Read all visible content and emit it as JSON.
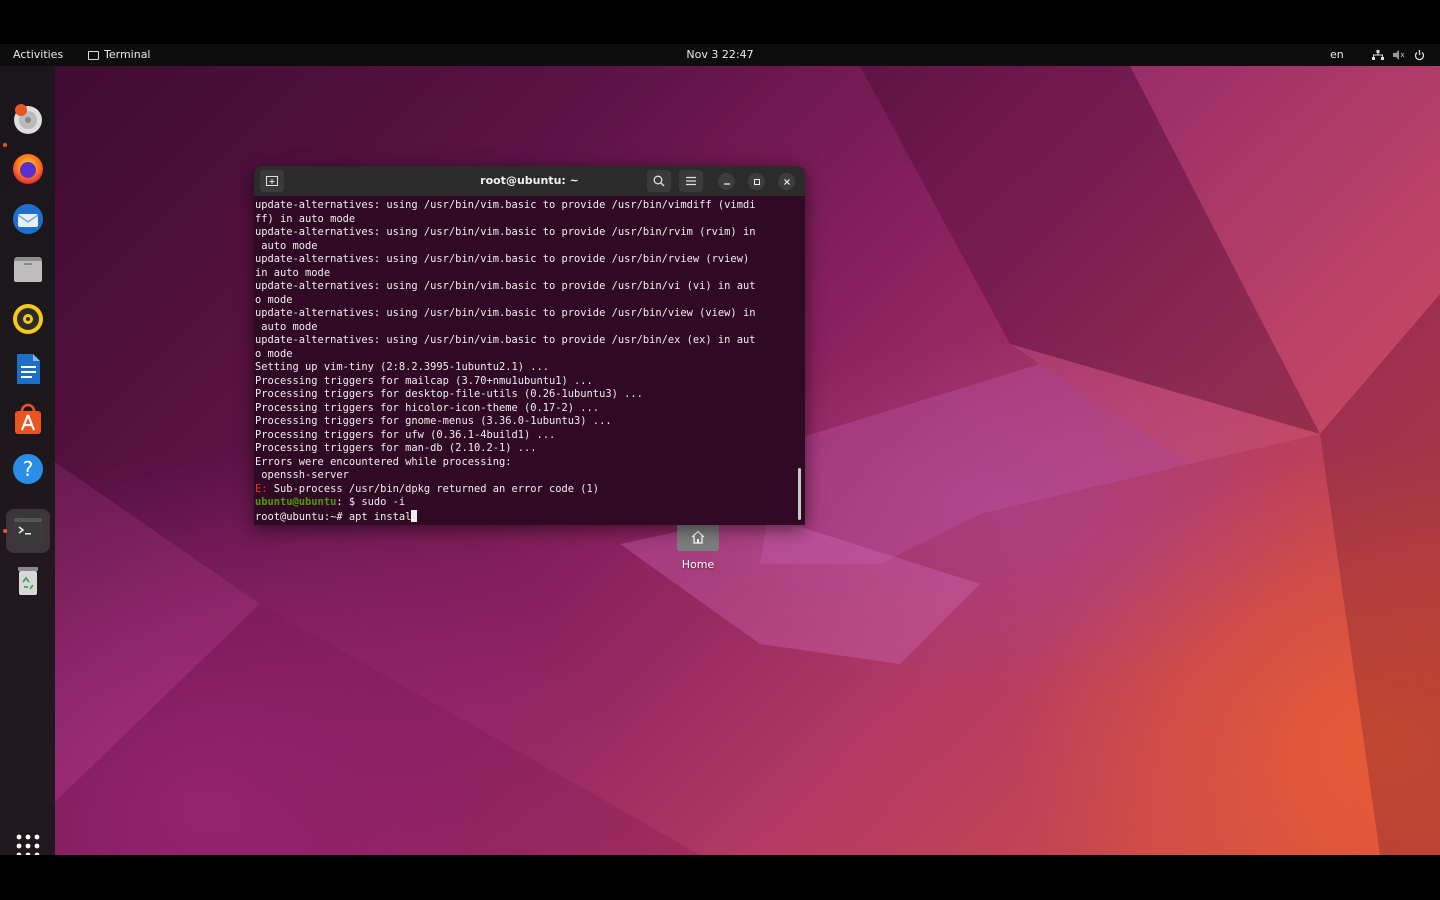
{
  "topbar": {
    "activities": "Activities",
    "app_name": "Terminal",
    "clock": "Nov 3  22:47",
    "lang": "en"
  },
  "dock": {
    "items": [
      {
        "icon": "installer-icon"
      },
      {
        "icon": "firefox-icon"
      },
      {
        "icon": "thunderbird-icon"
      },
      {
        "icon": "files-icon"
      },
      {
        "icon": "rhythmbox-icon"
      },
      {
        "icon": "libreoffice-writer-icon"
      },
      {
        "icon": "software-center-icon"
      },
      {
        "icon": "help-icon"
      },
      {
        "icon": "terminal-icon"
      },
      {
        "icon": "trash-icon"
      },
      {
        "icon": "show-apps-icon"
      }
    ]
  },
  "terminal": {
    "title": "root@ubuntu: ~",
    "lines": [
      "update-alternatives: using /usr/bin/vim.basic to provide /usr/bin/vimdiff (vimdi",
      "ff) in auto mode",
      "update-alternatives: using /usr/bin/vim.basic to provide /usr/bin/rvim (rvim) in",
      " auto mode",
      "update-alternatives: using /usr/bin/vim.basic to provide /usr/bin/rview (rview)",
      "in auto mode",
      "update-alternatives: using /usr/bin/vim.basic to provide /usr/bin/vi (vi) in aut",
      "o mode",
      "update-alternatives: using /usr/bin/vim.basic to provide /usr/bin/view (view) in",
      " auto mode",
      "update-alternatives: using /usr/bin/vim.basic to provide /usr/bin/ex (ex) in aut",
      "o mode",
      "Setting up vim-tiny (2:8.2.3995-1ubuntu2.1) ...",
      "Processing triggers for mailcap (3.70+nmu1ubuntu1) ...",
      "Processing triggers for desktop-file-utils (0.26-1ubuntu3) ...",
      "Processing triggers for hicolor-icon-theme (0.17-2) ...",
      "Processing triggers for gnome-menus (3.36.0-1ubuntu3) ...",
      "Processing triggers for ufw (0.36.1-4build1) ...",
      "Processing triggers for man-db (2.10.2-1) ...",
      "Errors were encountered while processing:",
      " openssh-server"
    ],
    "error_prefix": "E:",
    "error_text": " Sub-process /usr/bin/dpkg returned an error code (1)",
    "prompt_user": "ubuntu@ubuntu",
    "prompt_user_rest": ": $ sudo -i",
    "root_prompt": "root@ubuntu:~# ",
    "root_command": "apt instal"
  },
  "desktop": {
    "home_label": "Home"
  },
  "colors": {
    "terminal_bg": "#300a24",
    "accent": "#e95420",
    "error": "#ef2929",
    "prompt_green": "#4e9a06"
  }
}
